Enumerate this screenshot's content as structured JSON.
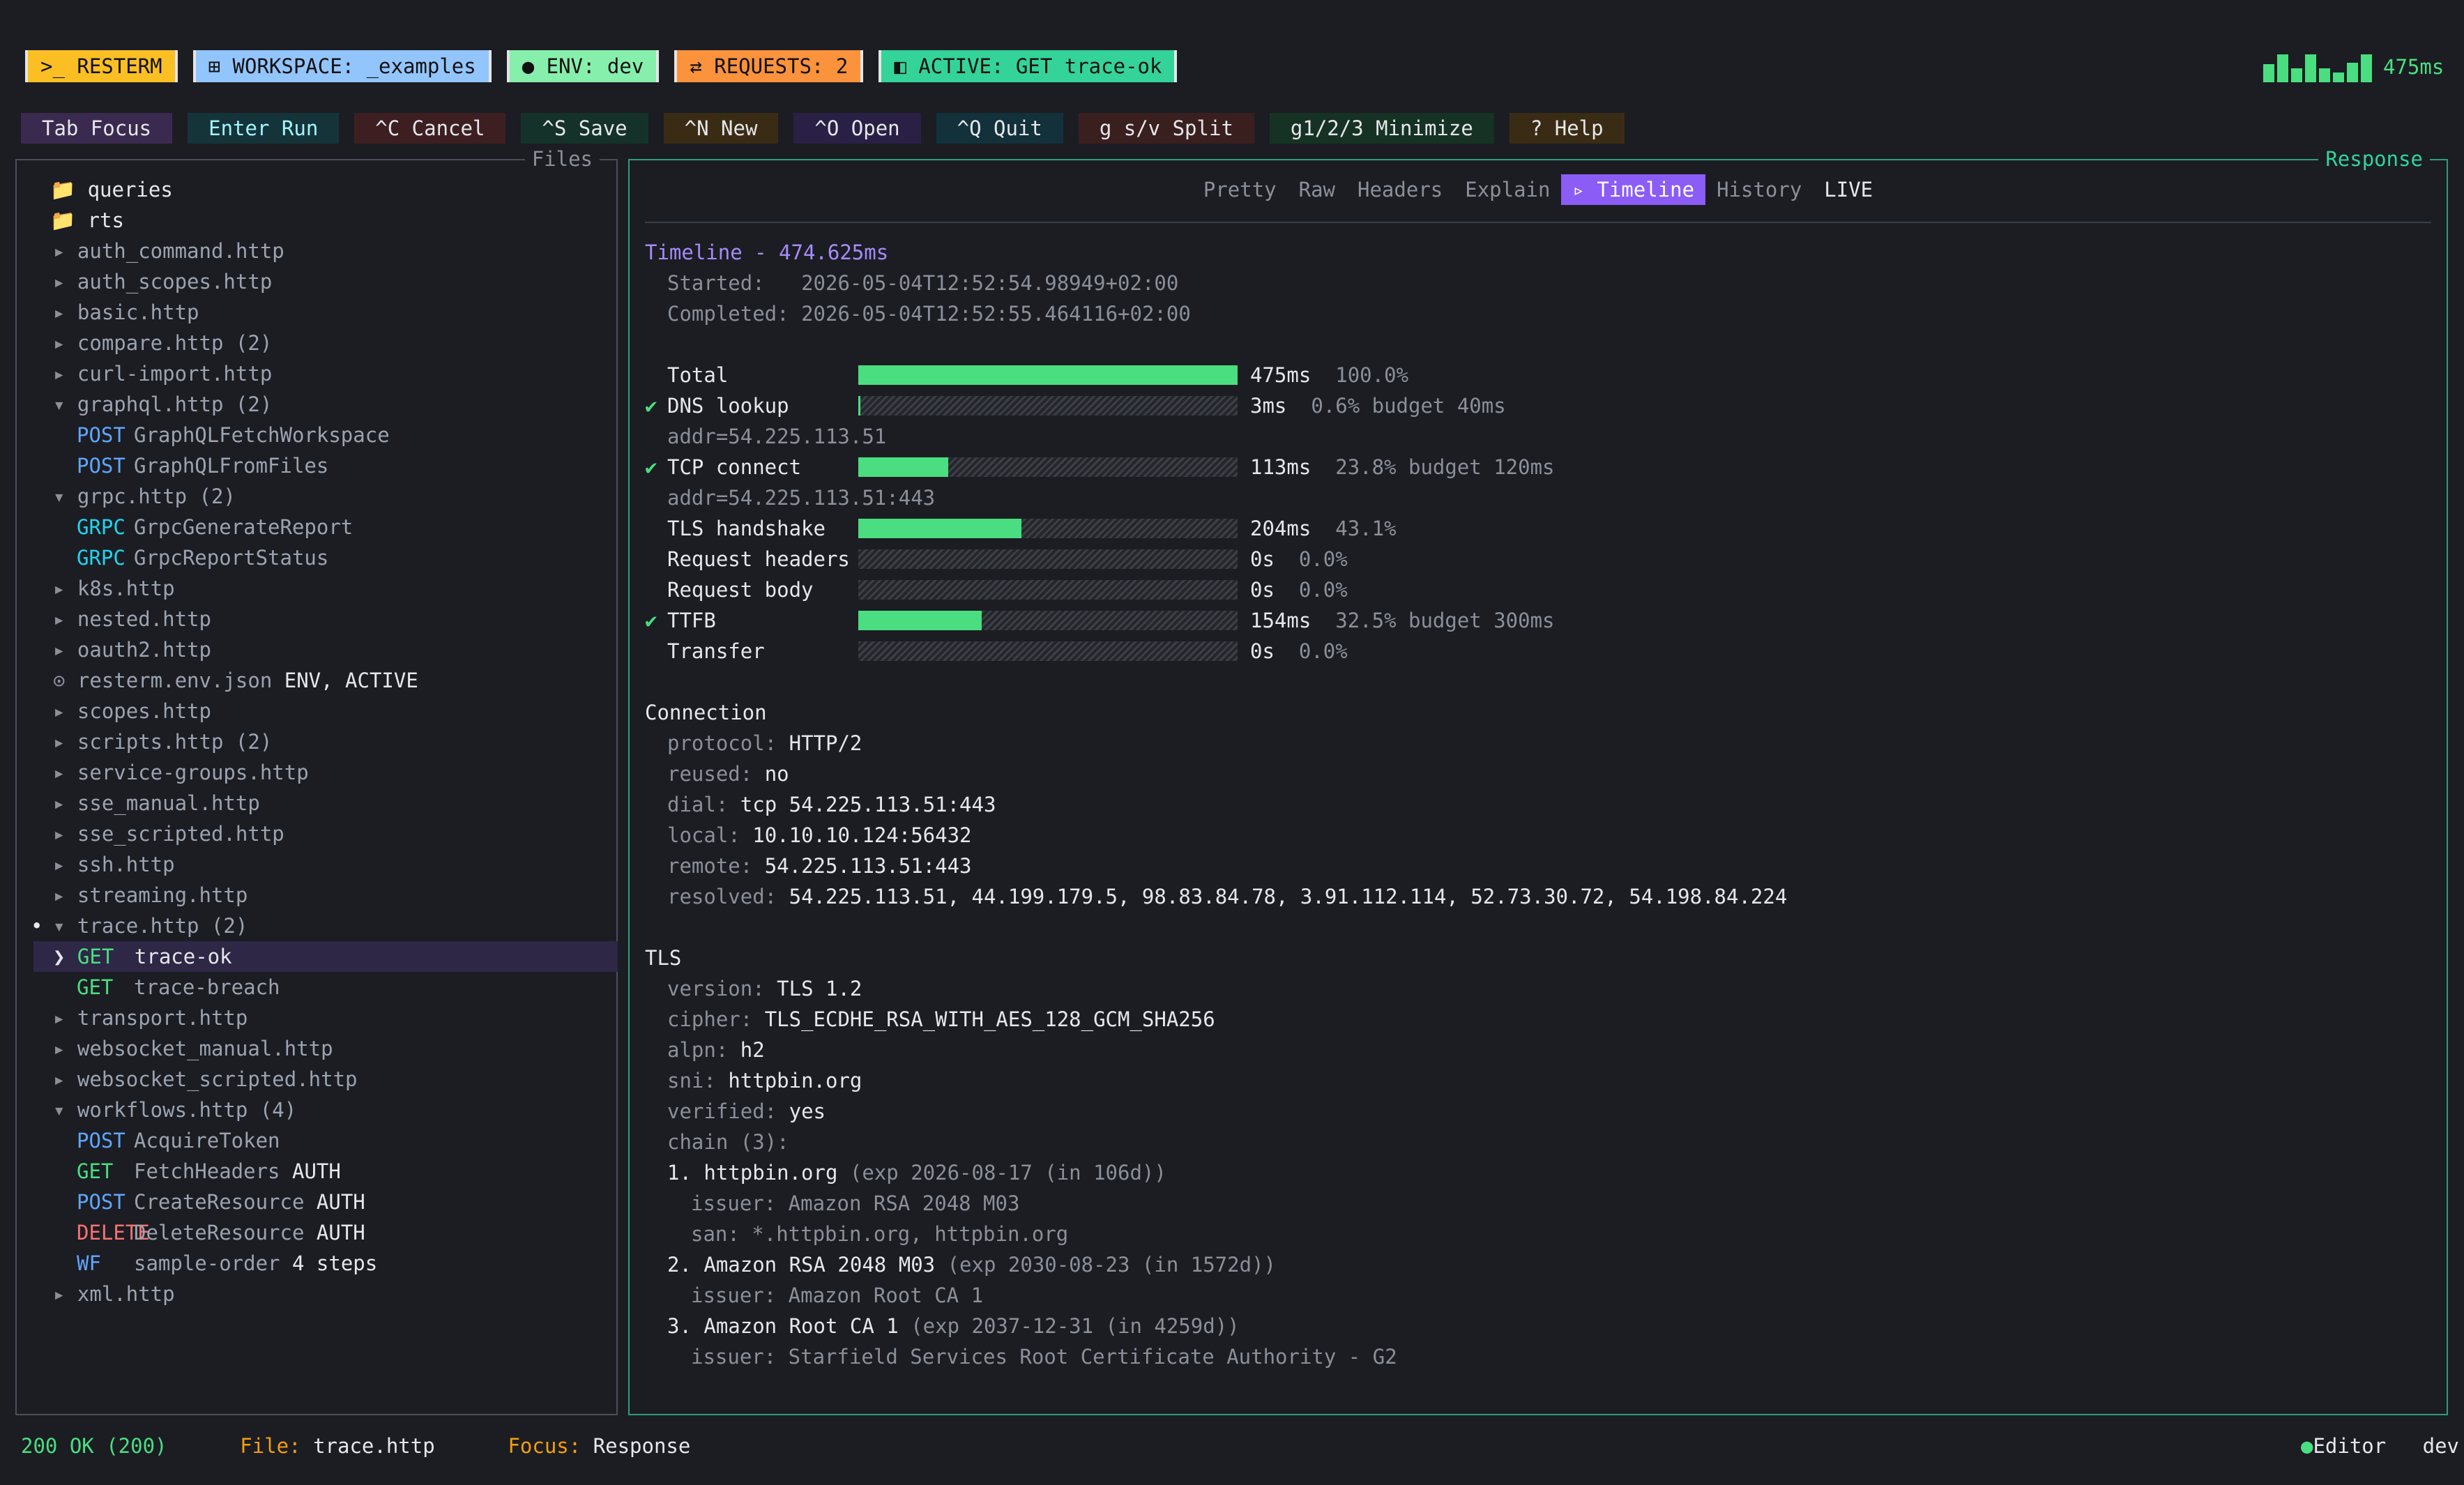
{
  "status_pills": {
    "resterm": ">_ RESTERM",
    "workspace": "⊞ WORKSPACE: _examples",
    "env": "● ENV: dev",
    "requests": "⇄ REQUESTS: 2",
    "active": "◧ ACTIVE: GET trace-ok"
  },
  "latency": "475ms",
  "keys": [
    "Tab Focus",
    "Enter Run",
    "^C Cancel",
    "^S Save",
    "^N New",
    "^O Open",
    "^Q Quit",
    "g s/v Split",
    "g1/2/3 Minimize",
    "? Help"
  ],
  "files": {
    "title": "Files",
    "tree": [
      {
        "type": "folder",
        "label": "queries"
      },
      {
        "type": "folder",
        "label": "rts"
      },
      {
        "type": "file",
        "label": "auth_command.http"
      },
      {
        "type": "file",
        "label": "auth_scopes.http"
      },
      {
        "type": "file",
        "label": "basic.http"
      },
      {
        "type": "file",
        "label": "compare.http (2)"
      },
      {
        "type": "file",
        "label": "curl-import.http"
      },
      {
        "type": "open",
        "label": "graphql.http (2)"
      },
      {
        "type": "req",
        "method": "POST",
        "label": "GraphQLFetchWorkspace"
      },
      {
        "type": "req",
        "method": "POST",
        "label": "GraphQLFromFiles"
      },
      {
        "type": "open",
        "label": "grpc.http (2)"
      },
      {
        "type": "req",
        "method": "GRPC",
        "label": "GrpcGenerateReport"
      },
      {
        "type": "req",
        "method": "GRPC",
        "label": "GrpcReportStatus"
      },
      {
        "type": "file",
        "label": "k8s.http"
      },
      {
        "type": "file",
        "label": "nested.http"
      },
      {
        "type": "file",
        "label": "oauth2.http"
      },
      {
        "type": "env",
        "label": "resterm.env.json",
        "extra": "ENV, ACTIVE"
      },
      {
        "type": "file",
        "label": "scopes.http"
      },
      {
        "type": "file",
        "label": "scripts.http (2)"
      },
      {
        "type": "file",
        "label": "service-groups.http"
      },
      {
        "type": "file",
        "label": "sse_manual.http"
      },
      {
        "type": "file",
        "label": "sse_scripted.http"
      },
      {
        "type": "file",
        "label": "ssh.http"
      },
      {
        "type": "file",
        "label": "streaming.http"
      },
      {
        "type": "open",
        "label": "trace.http (2)",
        "bullet": "•"
      },
      {
        "type": "req",
        "method": "GET",
        "label": "trace-ok",
        "selected": true
      },
      {
        "type": "req",
        "method": "GET",
        "label": "trace-breach"
      },
      {
        "type": "file",
        "label": "transport.http"
      },
      {
        "type": "file",
        "label": "websocket_manual.http"
      },
      {
        "type": "file",
        "label": "websocket_scripted.http"
      },
      {
        "type": "open",
        "label": "workflows.http (4)"
      },
      {
        "type": "req",
        "method": "POST",
        "label": "AcquireToken"
      },
      {
        "type": "req",
        "method": "GET",
        "label": "FetchHeaders",
        "extra": "AUTH"
      },
      {
        "type": "req",
        "method": "POST",
        "label": "CreateResource",
        "extra": "AUTH"
      },
      {
        "type": "req",
        "method": "DELETE",
        "label": "DeleteResource",
        "extra": "AUTH"
      },
      {
        "type": "req",
        "method": "WF",
        "label": "sample-order",
        "extra": "4 steps"
      },
      {
        "type": "file",
        "label": "xml.http"
      }
    ]
  },
  "response": {
    "title": "Response",
    "tabs": [
      "Pretty",
      "Raw",
      "Headers",
      "Explain",
      "▹ Timeline",
      "History",
      "LIVE"
    ],
    "active_tab": 4,
    "timeline_title": "Timeline - 474.625ms",
    "started_label": "Started:",
    "started": "2026-05-04T12:52:54.98949+02:00",
    "completed_label": "Completed:",
    "completed": "2026-05-04T12:52:55.464116+02:00",
    "phases": [
      {
        "name": "Total",
        "fraction": 1.0,
        "value": "475ms",
        "pct": "100.0%",
        "check": false
      },
      {
        "name": "DNS lookup",
        "fraction": 0.006,
        "value": "3ms",
        "pct": "0.6% budget 40ms",
        "check": true,
        "sub": "addr=54.225.113.51"
      },
      {
        "name": "TCP connect",
        "fraction": 0.238,
        "value": "113ms",
        "pct": "23.8% budget 120ms",
        "check": true,
        "sub": "addr=54.225.113.51:443"
      },
      {
        "name": "TLS handshake",
        "fraction": 0.431,
        "value": "204ms",
        "pct": "43.1%",
        "check": false
      },
      {
        "name": "Request headers",
        "fraction": 0,
        "value": "0s",
        "pct": "0.0%",
        "check": false
      },
      {
        "name": "Request body",
        "fraction": 0,
        "value": "0s",
        "pct": "0.0%",
        "check": false
      },
      {
        "name": "TTFB",
        "fraction": 0.325,
        "value": "154ms",
        "pct": "32.5% budget 300ms",
        "check": true
      },
      {
        "name": "Transfer",
        "fraction": 0,
        "value": "0s",
        "pct": "0.0%",
        "check": false
      }
    ],
    "connection_title": "Connection",
    "connection": [
      {
        "k": "protocol:",
        "v": "HTTP/2"
      },
      {
        "k": "reused:",
        "v": "no"
      },
      {
        "k": "dial:",
        "v": "tcp 54.225.113.51:443"
      },
      {
        "k": "local:",
        "v": "10.10.10.124:56432"
      },
      {
        "k": "remote:",
        "v": "54.225.113.51:443"
      },
      {
        "k": "resolved:",
        "v": "54.225.113.51, 44.199.179.5, 98.83.84.78, 3.91.112.114, 52.73.30.72, 54.198.84.224"
      }
    ],
    "tls_title": "TLS",
    "tls": [
      {
        "k": "version:",
        "v": "TLS 1.2"
      },
      {
        "k": "cipher:",
        "v": "TLS_ECDHE_RSA_WITH_AES_128_GCM_SHA256"
      },
      {
        "k": "alpn:",
        "v": "h2"
      },
      {
        "k": "sni:",
        "v": "httpbin.org"
      },
      {
        "k": "verified:",
        "v": "yes"
      },
      {
        "k": "chain (3):",
        "v": ""
      }
    ],
    "chain": [
      {
        "name": "1. httpbin.org",
        "exp": "(exp 2026-08-17 (in 106d))",
        "lines": [
          "issuer: Amazon RSA 2048 M03",
          "san: *.httpbin.org, httpbin.org"
        ]
      },
      {
        "name": "2. Amazon RSA 2048 M03",
        "exp": "(exp 2030-08-23 (in 1572d))",
        "lines": [
          "issuer: Amazon Root CA 1"
        ]
      },
      {
        "name": "3. Amazon Root CA 1",
        "exp": "(exp 2037-12-31 (in 4259d))",
        "lines": [
          "issuer: Starfield Services Root Certificate Authority - G2"
        ]
      }
    ]
  },
  "footer": {
    "status": "200 OK (200)",
    "file_label": "File:",
    "file": "trace.http",
    "focus_label": "Focus:",
    "focus": "Response",
    "mode": "Editor",
    "env": "dev"
  },
  "colors": {
    "accent": "#8b5cf6",
    "ok": "#4ade80",
    "border": "#2f9e78"
  }
}
